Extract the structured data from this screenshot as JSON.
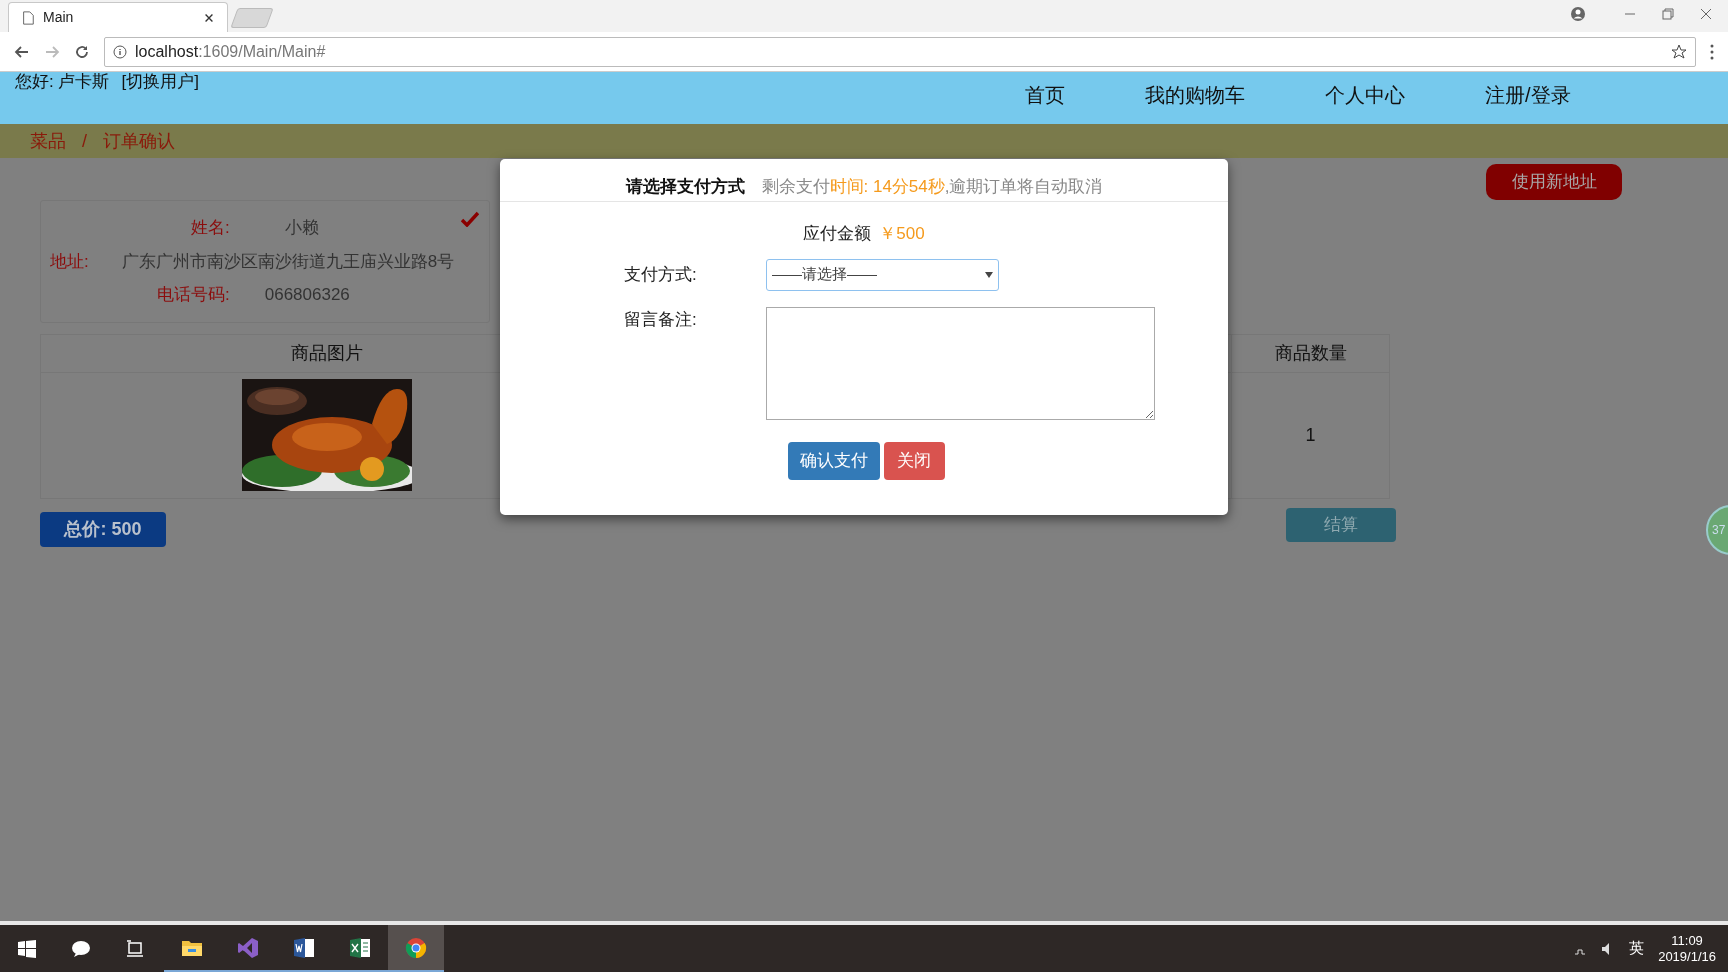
{
  "browser": {
    "tab_title": "Main",
    "url_host": "localhost",
    "url_path": ":1609/Main/Main#"
  },
  "header": {
    "greeting": "您好: 卢卡斯",
    "switch_user": "[切换用户]",
    "nav": [
      {
        "label": "首页"
      },
      {
        "label": "我的购物车"
      },
      {
        "label": "个人中心"
      },
      {
        "label": "注册/登录"
      }
    ]
  },
  "breadcrumb": [
    "菜品",
    "/",
    "订单确认"
  ],
  "new_address_button": "使用新地址",
  "address": {
    "checked": true,
    "fields": [
      {
        "label": "姓名:",
        "value": "小赖"
      },
      {
        "label": "地址:",
        "value": "广东广州市南沙区南沙街道九王庙兴业路8号"
      },
      {
        "label": "电话号码:",
        "value": "066806326"
      }
    ]
  },
  "table": {
    "columns": [
      "商品图片",
      "商品数量"
    ],
    "rows": [
      {
        "quantity": "1"
      }
    ]
  },
  "total_button": "总价: 500",
  "checkout_button": "结算",
  "floating_badge": "37",
  "dialog": {
    "title": "请选择支付方式",
    "notice_prefix": "剩余支付",
    "notice_time": "时间: 14分54秒",
    "notice_suffix": ",逾期订单将自动取消",
    "amount_label": "应付金额",
    "amount": "￥500",
    "payment_label": "支付方式:",
    "payment_select": "——请选择——",
    "remark_label": "留言备注:",
    "confirm_button": "确认支付",
    "close_button": "关闭"
  },
  "taskbar": {
    "apps": [
      {
        "kind": "explorer",
        "selected": false
      },
      {
        "kind": "vs",
        "selected": false
      },
      {
        "kind": "word",
        "selected": false
      },
      {
        "kind": "excel",
        "selected": false
      },
      {
        "kind": "chrome",
        "selected": true
      }
    ],
    "ime": "英",
    "time": "11:09",
    "date": "2019/1/16"
  }
}
